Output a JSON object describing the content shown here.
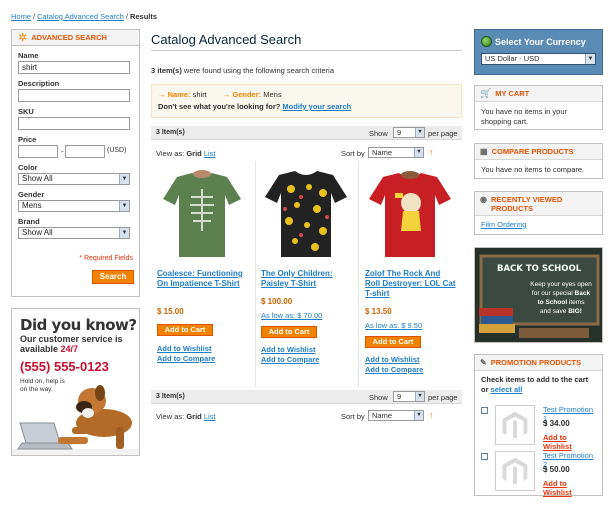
{
  "breadcrumb": {
    "home": "Home",
    "sep": "/",
    "catalog": "Catalog Advanced Search",
    "current": "Results"
  },
  "advanced_search": {
    "title": "ADVANCED SEARCH",
    "name_label": "Name",
    "name_value": "shirt",
    "description_label": "Description",
    "description_value": "",
    "sku_label": "SKU",
    "sku_value": "",
    "price_label": "Price",
    "price_from": "",
    "price_dash": "-",
    "price_to": "",
    "price_currency": "(USD)",
    "color_label": "Color",
    "color_value": "Show All",
    "gender_label": "Gender",
    "gender_value": "Mens",
    "brand_label": "Brand",
    "brand_value": "Show All",
    "required_note": "* Required Fields",
    "search_button": "Search"
  },
  "promo": {
    "headline": "Did you know?",
    "line1": "Our customer service is",
    "line2a": "available ",
    "line2b": "24/7",
    "phone": "(555) 555-0123",
    "hold1": "Hold on, help is",
    "hold2": "on the way."
  },
  "main": {
    "title": "Catalog Advanced Search",
    "found_count": "3 item(s)",
    "found_text": " were found using the following search criteria",
    "criteria_name_label": "Name:",
    "criteria_name_value": " shirt",
    "criteria_gender_label": "Gender:",
    "criteria_gender_value": " Mens",
    "not_found": "Don't see what you're looking for? ",
    "modify_link": "Modify your search"
  },
  "toolbar": {
    "count": "3 Item(s)",
    "show": "Show",
    "per_page_value": "9",
    "per_page": "per page",
    "view_as": "View as:",
    "grid": "Grid",
    "list": "List",
    "sort_by": "Sort by",
    "sort_value": "Name",
    "sort_dir": "↑"
  },
  "products": [
    {
      "name": "Coalesce: Functioning On Impatience T-Shirt",
      "price": "$ 15.00",
      "as_low": "",
      "add_to_cart": "Add to Cart",
      "wishlist": "Add to Wishlist",
      "compare": "Add to Compare",
      "shirt_color": "#5c8050"
    },
    {
      "name": "The Only Children: Paisley T-Shirt",
      "price": "$ 100.00",
      "as_low": "As low as: $ 70.00",
      "add_to_cart": "Add to Cart",
      "wishlist": "Add to Wishlist",
      "compare": "Add to Compare",
      "shirt_color": "#222222"
    },
    {
      "name": "Zolof The Rock And Roll Destroyer: LOL Cat T-shirt",
      "price": "$ 13.50",
      "as_low": "As low as: $ 9.50",
      "add_to_cart": "Add to Cart",
      "wishlist": "Add to Wishlist",
      "compare": "Add to Compare",
      "shirt_color": "#c81f24"
    }
  ],
  "currency": {
    "title": "Select Your Currency",
    "value": "US Dollar - USD"
  },
  "cart": {
    "title": "MY CART",
    "text": "You have no items in your shopping cart."
  },
  "compare": {
    "title": "COMPARE PRODUCTS",
    "text": "You have no items to compare."
  },
  "recent": {
    "title": "RECENTLY VIEWED PRODUCTS",
    "item": "Film Ordering"
  },
  "school": {
    "title": "BACK TO SCHOOL",
    "t1": "Keep your eyes open",
    "t2": "for our special ",
    "t2b": "Back",
    "t3b": "to School",
    "t3": " items",
    "t4": "and save ",
    "t4b": "BIG!"
  },
  "promo_products": {
    "title": "PROMOTION PRODUCTS",
    "intro": "Check items to add to the cart or ",
    "select_all": "select all",
    "items": [
      {
        "name": "Test Promotion 1",
        "price": "$ 34.00",
        "wishlist": "Add to Wishlist"
      },
      {
        "name": "Test Promotion 2",
        "price": "$ 50.00",
        "wishlist": "Add to Wishlist"
      }
    ]
  }
}
